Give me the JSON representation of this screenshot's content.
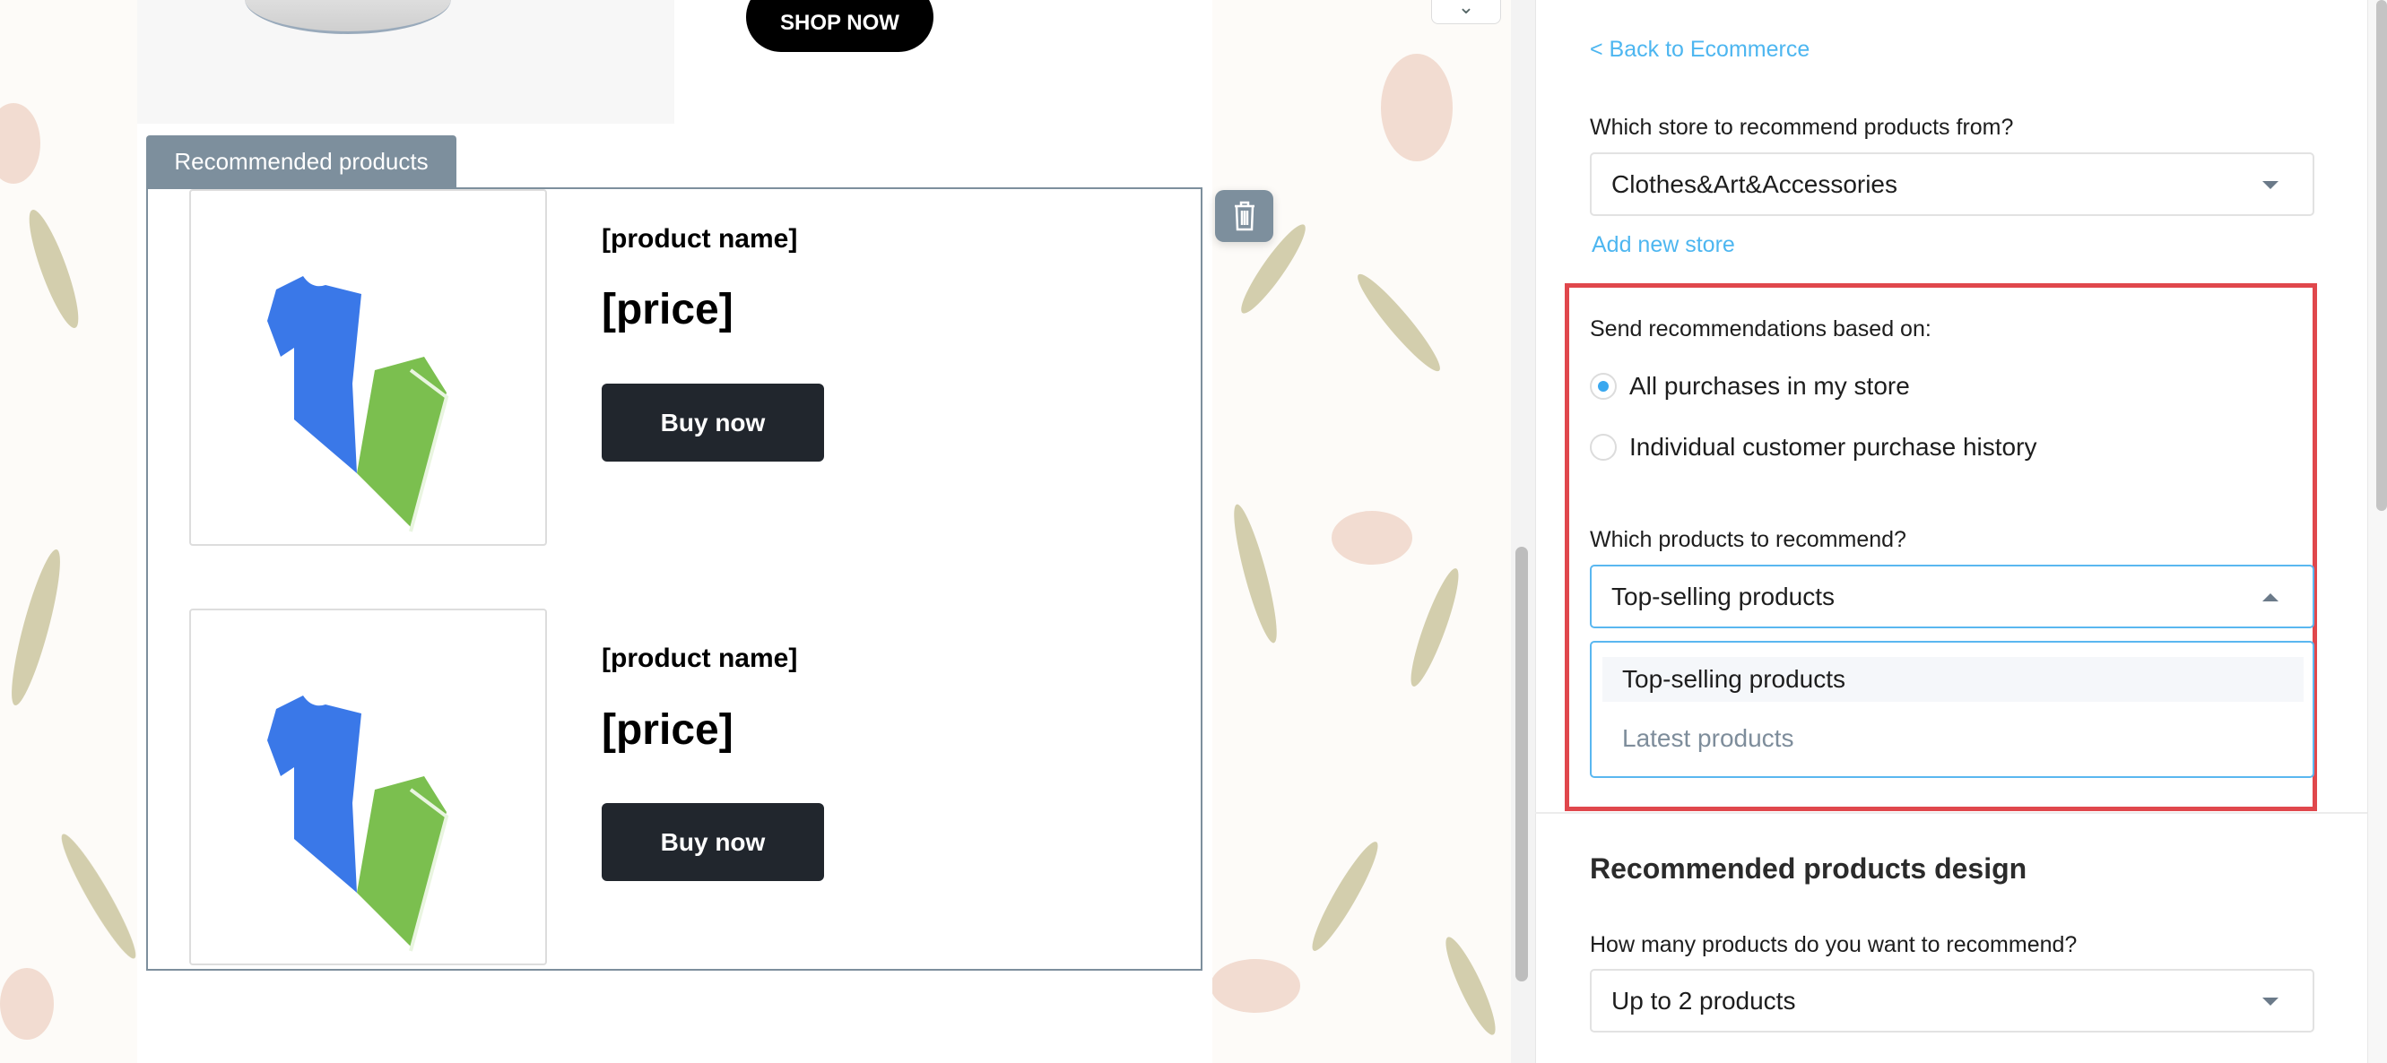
{
  "email": {
    "shop_now": "SHOP NOW",
    "section_tab": "Recommended products",
    "products": [
      {
        "name": "[product name]",
        "price": "[price]",
        "button": "Buy now"
      },
      {
        "name": "[product name]",
        "price": "[price]",
        "button": "Buy now"
      }
    ]
  },
  "panel": {
    "back_link": "< Back to Ecommerce",
    "store_label": "Which store to recommend products from?",
    "store_value": "Clothes&Art&Accessories",
    "add_store": "Add new store",
    "based_on_label": "Send recommendations based on:",
    "based_on_options": [
      {
        "label": "All purchases in my store",
        "selected": true
      },
      {
        "label": "Individual customer purchase history",
        "selected": false
      }
    ],
    "which_products_label": "Which products to recommend?",
    "which_products_value": "Top-selling products",
    "which_products_options": [
      "Top-selling products",
      "Latest products"
    ],
    "design_heading": "Recommended products design",
    "how_many_label": "How many products do you want to recommend?",
    "how_many_value": "Up to 2 products"
  },
  "colors": {
    "accent": "#4db6f0",
    "highlight_box": "#e0474c",
    "tab": "#7d8f9d",
    "button": "#21262d"
  }
}
